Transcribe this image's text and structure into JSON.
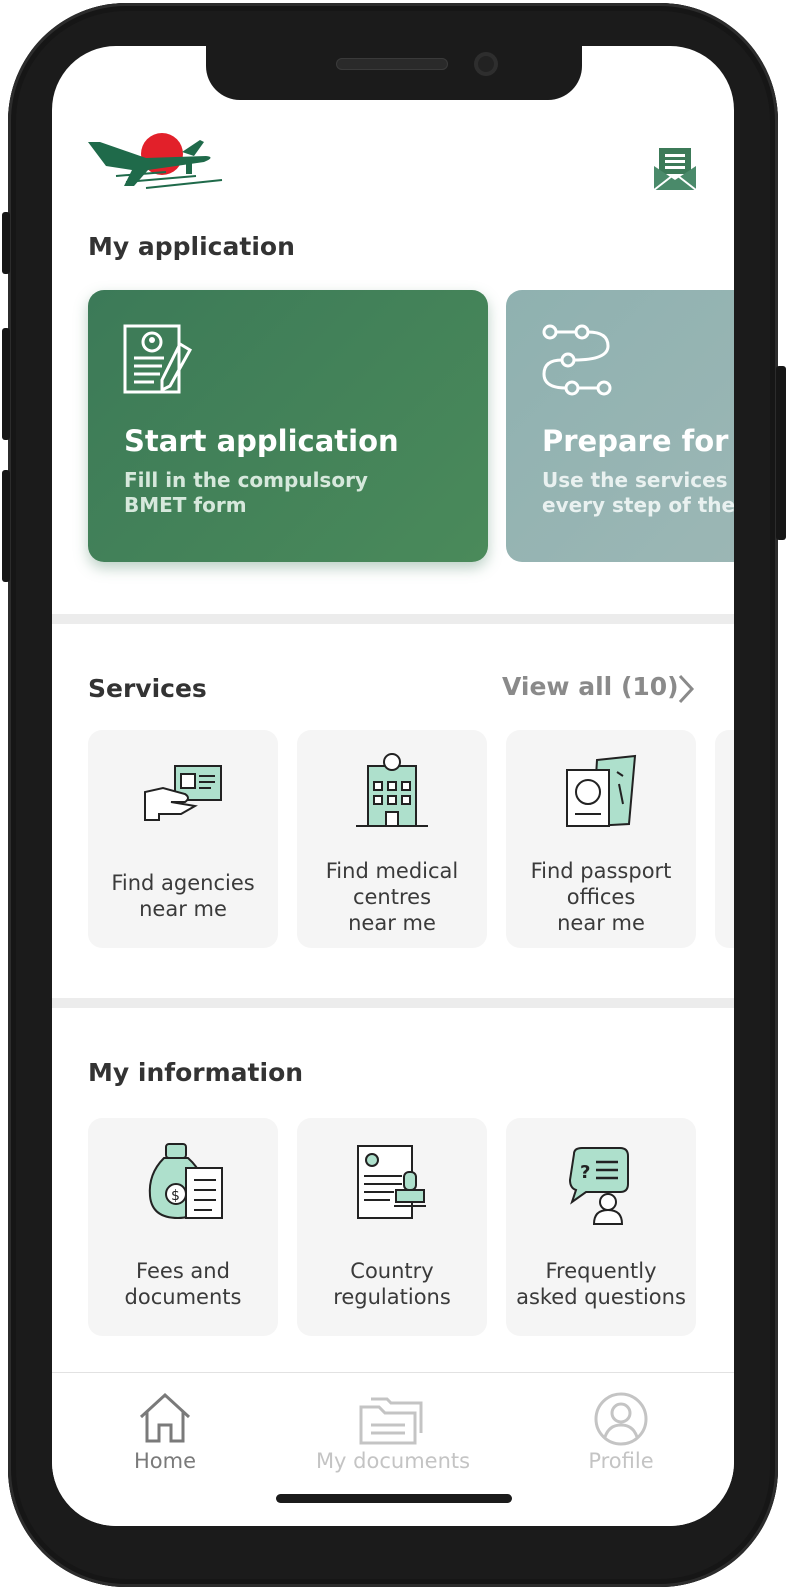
{
  "colors": {
    "primary": "#3c7a58",
    "prepare_card": "#9cb7b5",
    "tile_bg": "#f5f5f5",
    "icon_mint": "#aee0cc"
  },
  "header": {
    "logo_icon": "airplane-sun-logo",
    "inbox_icon": "mail-open-icon"
  },
  "my_application": {
    "title": "My application",
    "cards": [
      {
        "title": "Start application",
        "subtitle_line1": "Fill in the compulsory",
        "subtitle_line2": "BMET form",
        "icon": "application-form-icon"
      },
      {
        "title": "Prepare for jobs",
        "subtitle_line1": "Use the services to",
        "subtitle_line2": "every step of the way",
        "icon": "steps-flow-icon"
      }
    ]
  },
  "services": {
    "title": "Services",
    "view_all": "View all (10)",
    "items": [
      {
        "line1": "Find agencies",
        "line2": "near me",
        "icon": "agency-card-icon"
      },
      {
        "line1": "Find medical",
        "line2": "centres",
        "line3": "near me",
        "icon": "medical-centre-icon"
      },
      {
        "line1": "Find passport",
        "line2": "offices",
        "line3": "near me",
        "icon": "passport-icon"
      }
    ]
  },
  "my_information": {
    "title": "My information",
    "items": [
      {
        "line1": "Fees and",
        "line2": "documents",
        "icon": "money-bag-icon"
      },
      {
        "line1": "Country",
        "line2": "regulations",
        "icon": "regulation-stamp-icon"
      },
      {
        "line1": "Frequently",
        "line2": "asked questions",
        "icon": "faq-chat-icon"
      }
    ]
  },
  "bottom_nav": [
    {
      "label": "Home",
      "icon": "home-icon",
      "active": true
    },
    {
      "label": "My documents",
      "icon": "folder-icon",
      "active": false
    },
    {
      "label": "Profile",
      "icon": "profile-icon",
      "active": false
    }
  ]
}
